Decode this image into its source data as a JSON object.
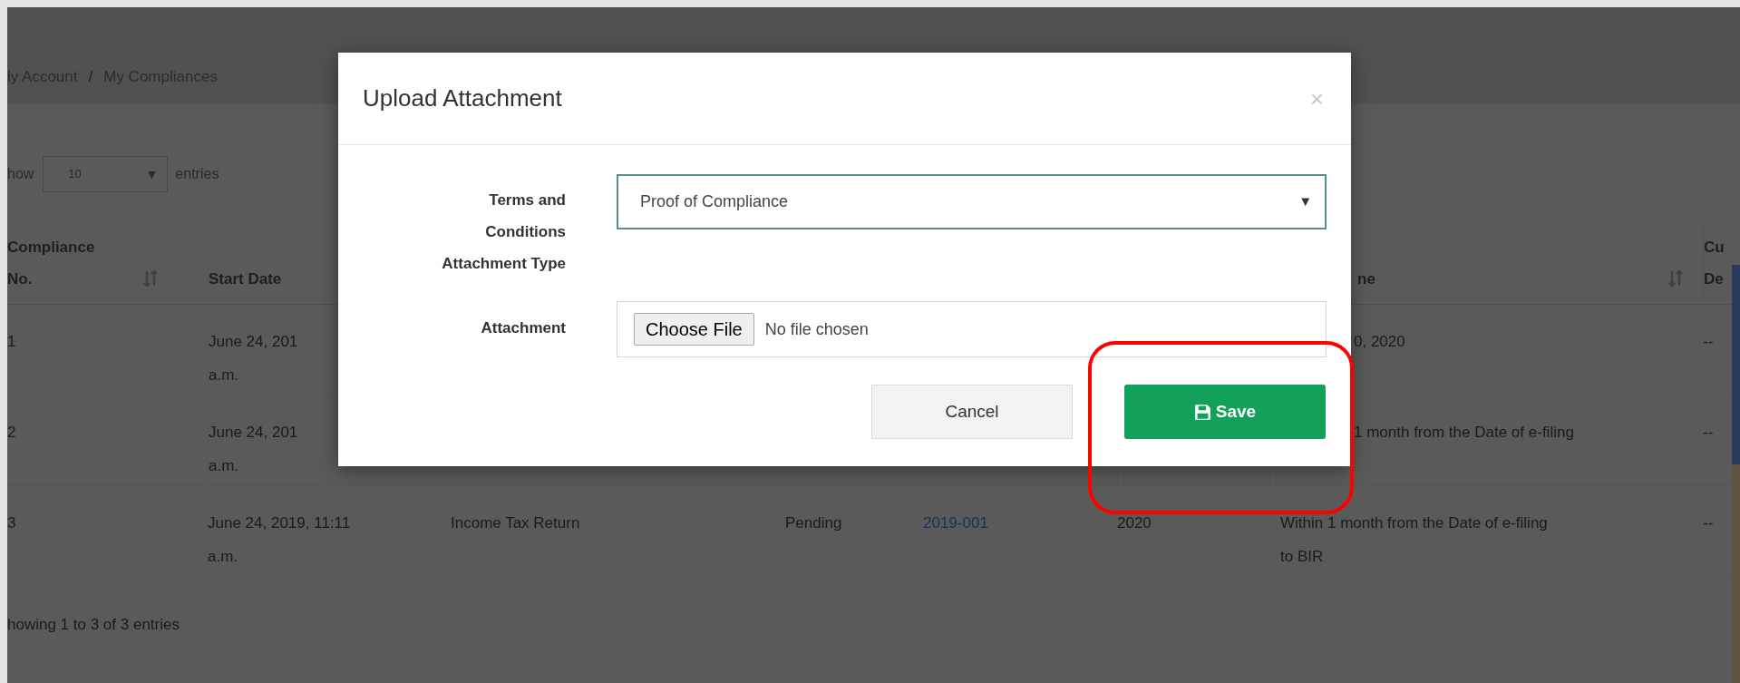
{
  "breadcrumb": {
    "items": [
      "ly Account",
      "My Compliances"
    ],
    "separator": "/"
  },
  "length_menu": {
    "prefix": "how",
    "value": "10",
    "arrow": "▼",
    "suffix": "entries"
  },
  "table": {
    "columns": [
      {
        "label": "Compliance\nNo.",
        "sort_icon": true
      },
      {
        "label": "Start Date"
      },
      null,
      null,
      null,
      null,
      {
        "label": "ne",
        "sort_icon": true
      },
      {
        "label": "Cu\nDe"
      }
    ],
    "rows": [
      {
        "cells": [
          "1",
          "June 24, 201\na.m.",
          null,
          null,
          null,
          null,
          "0, 2020",
          "--"
        ]
      },
      {
        "cells": [
          "2",
          "June 24, 201\na.m.",
          null,
          null,
          null,
          null,
          "1 month from the Date of e-filing",
          "--"
        ]
      },
      {
        "cells": [
          "3",
          "June 24, 2019, 11:11\na.m.",
          "Income Tax Return",
          "Pending",
          {
            "kind": "link",
            "text": "2019-001"
          },
          "2020",
          "Within 1 month from the Date of e-filing\nto BIR",
          "--"
        ]
      }
    ]
  },
  "info": "howing 1 to 3 of 3 entries",
  "modal": {
    "title": "Upload Attachment",
    "close": "×",
    "fields": [
      {
        "kind": "select",
        "label": "Terms and\nConditions\nAttachment Type",
        "value": "Proof of Compliance",
        "arrow": "▼"
      },
      {
        "kind": "file",
        "label": "Attachment",
        "button": "Choose File",
        "status": "No file chosen"
      }
    ],
    "buttons": [
      {
        "kind": "cancel",
        "label": "Cancel"
      },
      {
        "kind": "save",
        "label": "Save"
      }
    ]
  }
}
